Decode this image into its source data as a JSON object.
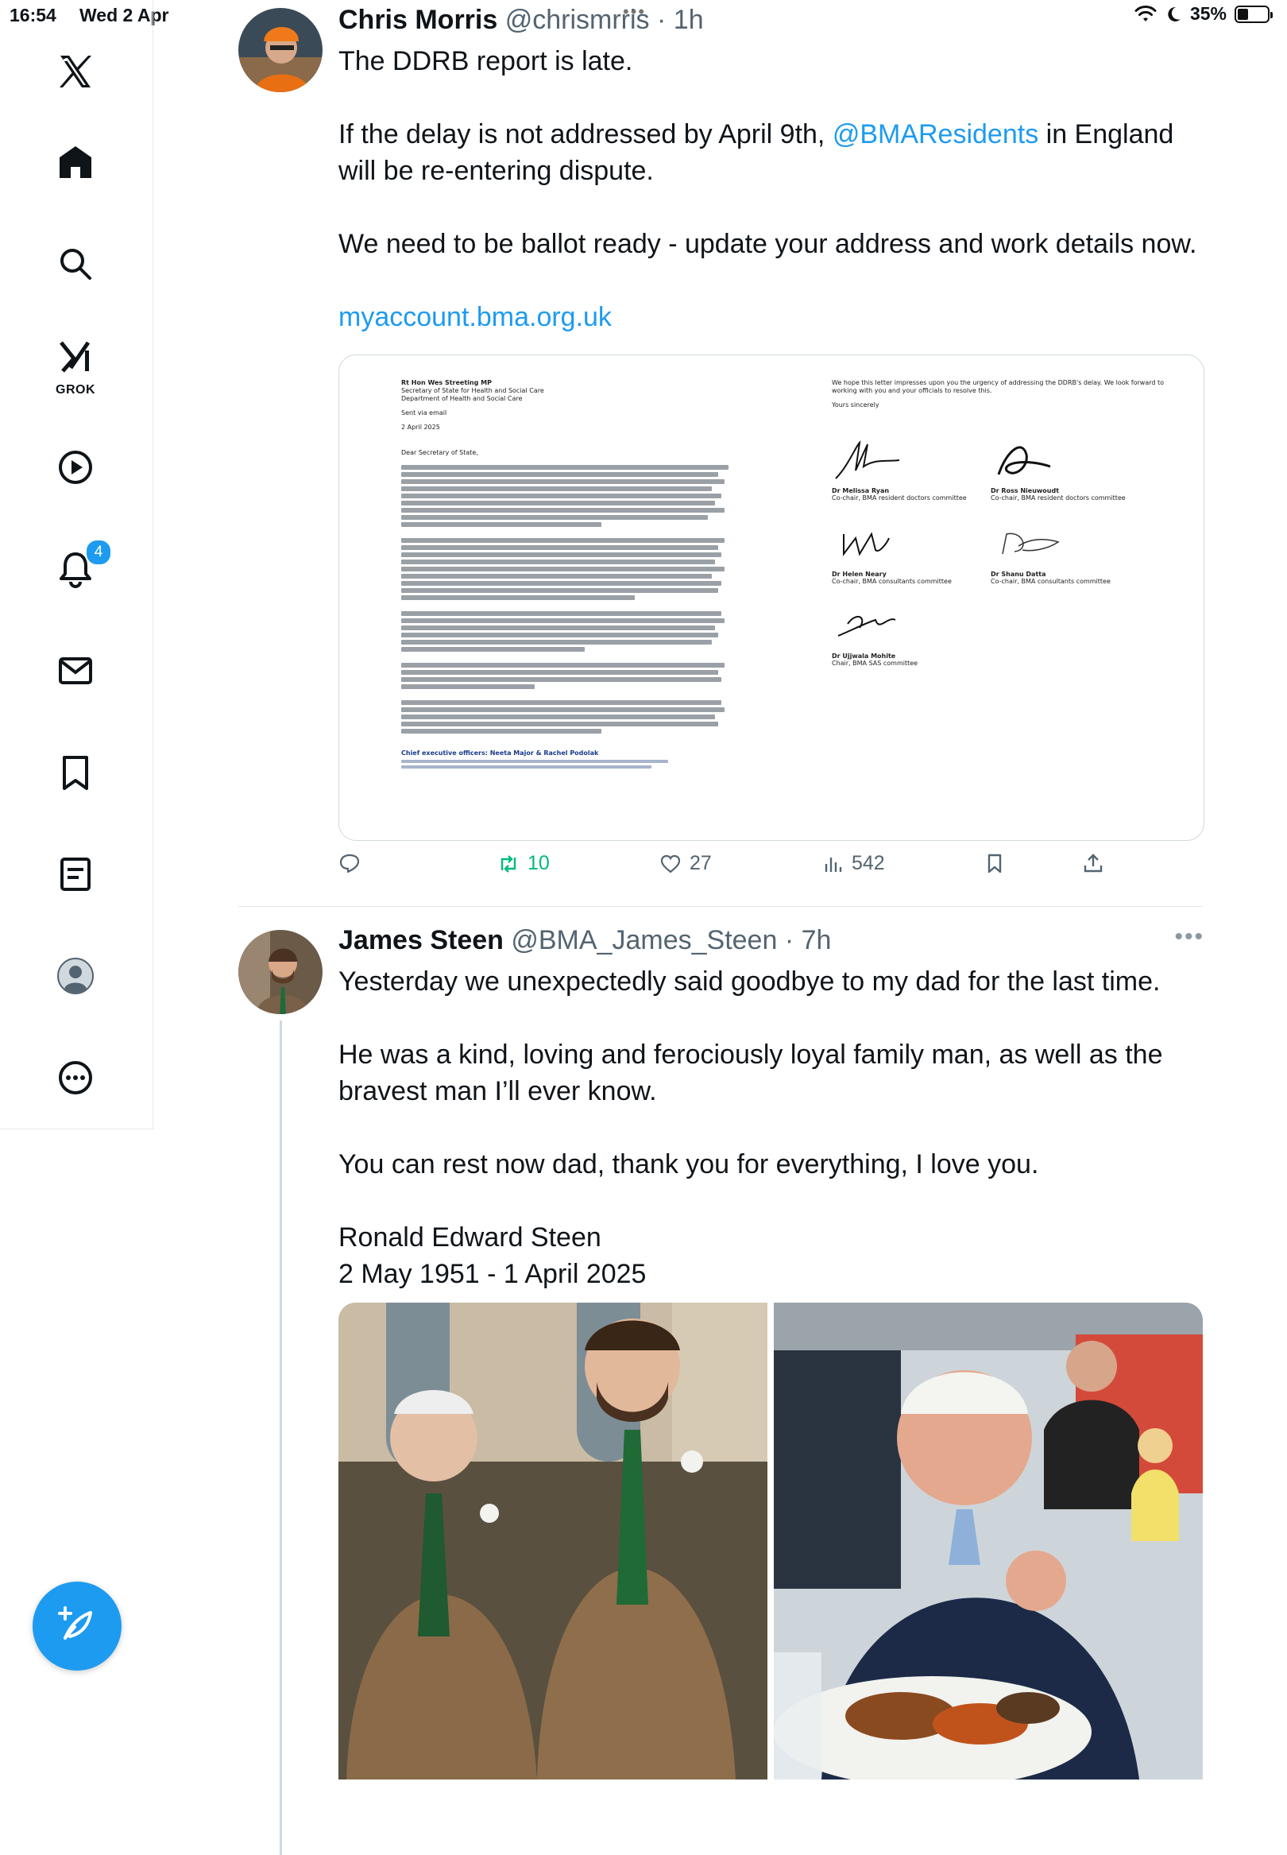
{
  "status_bar": {
    "time": "16:54",
    "date": "Wed 2 Apr",
    "battery": "35%",
    "battery_level": 0.35,
    "handle_dots": "•••"
  },
  "sidebar": {
    "items": [
      {
        "icon": "x-logo-icon"
      },
      {
        "icon": "home-icon"
      },
      {
        "icon": "search-icon"
      },
      {
        "icon": "grok-icon",
        "label": "GROK"
      },
      {
        "icon": "video-icon"
      },
      {
        "icon": "bell-icon",
        "badge": "4"
      },
      {
        "icon": "mail-icon"
      },
      {
        "icon": "bookmark-icon"
      },
      {
        "icon": "lists-icon"
      },
      {
        "icon": "profile-icon"
      },
      {
        "icon": "more-icon"
      }
    ],
    "compose_icon": "compose-icon"
  },
  "colors": {
    "accent": "#1d9bf0",
    "retweet_active": "#00ba7c",
    "secondary_text": "#536471"
  },
  "tweets": [
    {
      "name": "Chris Morris",
      "handle": "@chrismrris",
      "dot": "·",
      "time": "1h",
      "body_1": "The DDRB report is late.",
      "body_2a": "If the delay is not addressed by April 9th, ",
      "mention": "@BMAResidents",
      "body_2b": " in England will be re-entering dispute.",
      "body_3": "We need to be ballot ready - update your address and work details now.",
      "link": "myaccount.bma.org.uk",
      "letter": {
        "addressee": [
          "Rt Hon Wes Streeting MP",
          "Secretary of State for Health and Social Care",
          "Department of Health and Social Care"
        ],
        "sent_via": "Sent via email",
        "date": "2 April 2025",
        "salutation": "Dear Secretary of State,",
        "footer_label": "Chief executive officers: Neeta Major & Rachel Podolak",
        "closing_1": "We hope this letter impresses upon you the urgency of addressing the DDRB's delay. We look forward to working with you and your officials to resolve this.",
        "closing_2": "Yours sincerely",
        "signatories": [
          {
            "name": "Dr Melissa Ryan",
            "role": "Co-chair, BMA resident doctors committee"
          },
          {
            "name": "Dr Ross Nieuwoudt",
            "role": "Co-chair, BMA resident doctors committee"
          },
          {
            "name": "Dr Helen Neary",
            "role": "Co-chair, BMA consultants committee"
          },
          {
            "name": "Dr Shanu Datta",
            "role": "Co-chair, BMA consultants committee"
          },
          {
            "name": "Dr Ujjwala Mohite",
            "role": "Chair, BMA SAS committee"
          }
        ]
      },
      "actions": {
        "replies": "",
        "retweets": "10",
        "likes": "27",
        "views": "542"
      }
    },
    {
      "name": "James Steen",
      "handle": "@BMA_James_Steen",
      "dot": "·",
      "time": "7h",
      "more": "•••",
      "body_1": "Yesterday we unexpectedly said goodbye to my dad for the last time.",
      "body_2": "He was a kind, loving and ferociously loyal family man, as well as the bravest man I’ll ever know.",
      "body_3": "You can rest now dad, thank you for everything, I love you.",
      "body_4a": "Ronald Edward Steen",
      "body_4b": "2 May 1951 - 1 April 2025"
    }
  ]
}
